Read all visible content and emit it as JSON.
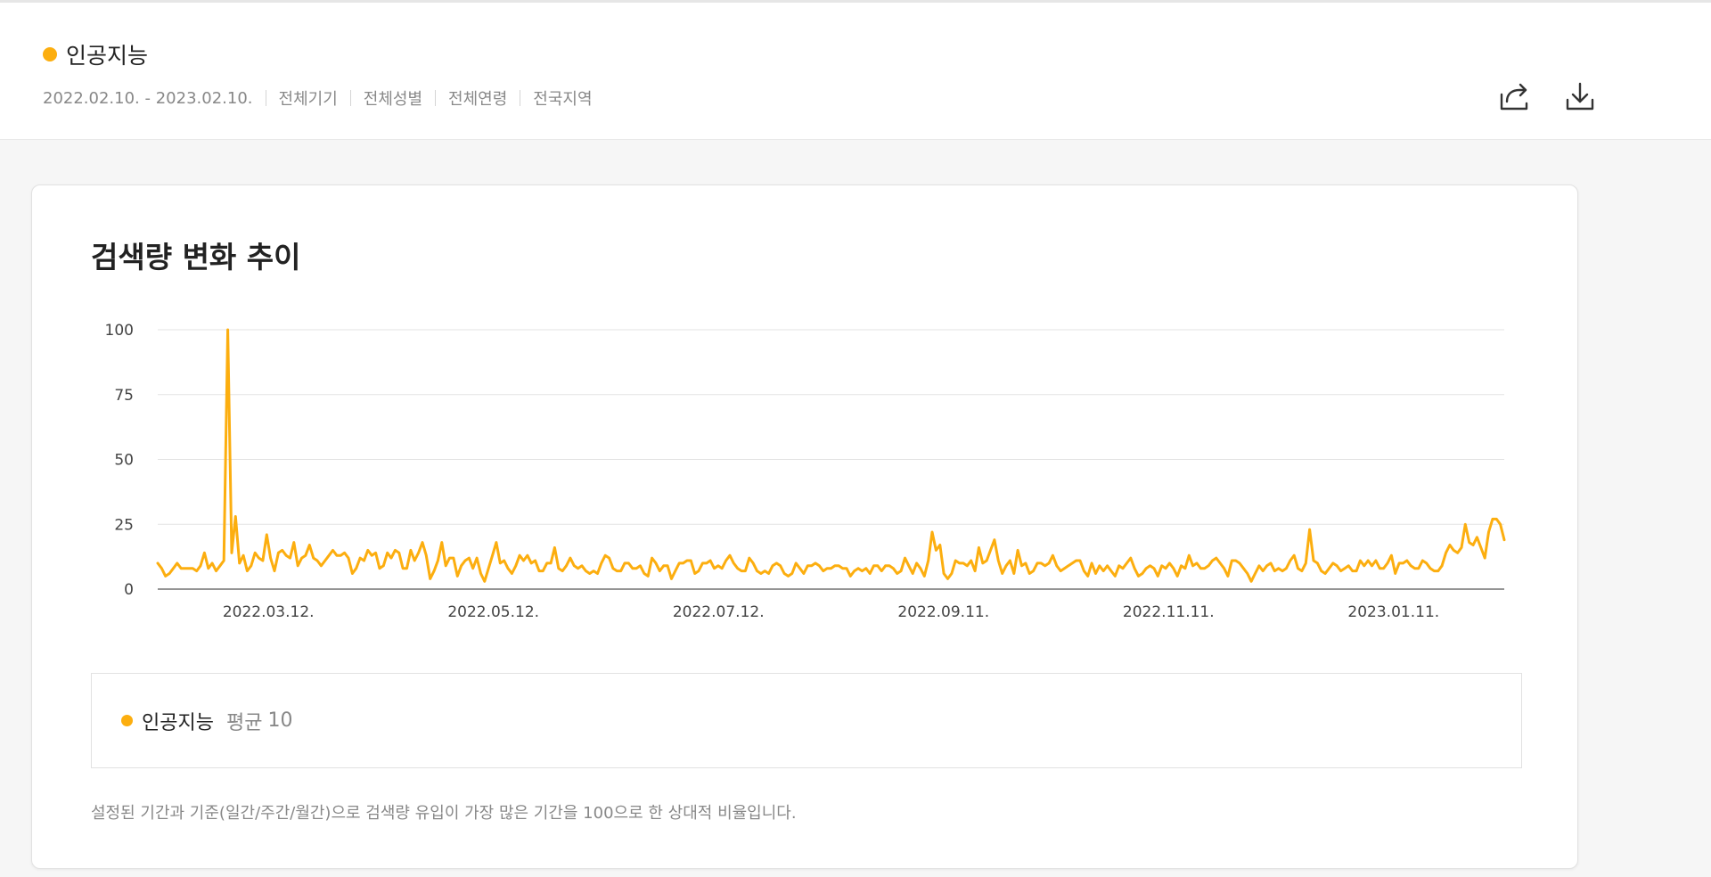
{
  "header": {
    "keyword": "인공지능",
    "filters": [
      "2022.02.10. - 2023.02.10.",
      "전체기기",
      "전체성별",
      "전체연령",
      "전국지역"
    ],
    "share_icon": "share-icon",
    "download_icon": "download-icon"
  },
  "colors": {
    "accent": "#fcae0f",
    "grid": "#e3e3e3",
    "axis": "#555555"
  },
  "card": {
    "title": "검색량 변화 추이",
    "legend": {
      "name": "인공지능",
      "avg_label": "평균",
      "avg_value": "10"
    },
    "note": "설정된 기간과 기준(일간/주간/월간)으로 검색량 유입이 가장 많은 기간을 100으로 한 상대적 비율입니다."
  },
  "chart_data": {
    "type": "line",
    "title": "검색량 변화 추이",
    "xlabel": "",
    "ylabel": "",
    "ylim": [
      0,
      100
    ],
    "yticks": [
      0,
      25,
      50,
      75,
      100
    ],
    "grid": true,
    "x_start": "2022.02.10.",
    "x_end": "2023.02.10.",
    "xticks": [
      "2022.03.12.",
      "2022.05.12.",
      "2022.07.12.",
      "2022.09.11.",
      "2022.11.11.",
      "2023.01.11."
    ],
    "series": [
      {
        "name": "인공지능",
        "color": "#fcae0f",
        "values": [
          10,
          8,
          5,
          6,
          8,
          10,
          8,
          8,
          8,
          8,
          7,
          9,
          14,
          8,
          10,
          7,
          9,
          11,
          100,
          14,
          28,
          10,
          13,
          7,
          9,
          14,
          12,
          11,
          21,
          12,
          7,
          14,
          15,
          13,
          12,
          18,
          9,
          12,
          13,
          17,
          12,
          11,
          9,
          11,
          13,
          15,
          13,
          13,
          14,
          12,
          6,
          8,
          12,
          11,
          15,
          13,
          14,
          8,
          9,
          14,
          12,
          15,
          14,
          8,
          8,
          15,
          11,
          14,
          18,
          13,
          4,
          7,
          11,
          18,
          9,
          12,
          12,
          5,
          9,
          11,
          12,
          8,
          12,
          6,
          3,
          8,
          13,
          18,
          10,
          11,
          8,
          6,
          9,
          13,
          11,
          13,
          10,
          11,
          7,
          7,
          10,
          10,
          16,
          8,
          7,
          9,
          12,
          9,
          8,
          9,
          7,
          6,
          7,
          6,
          10,
          13,
          12,
          8,
          7,
          7,
          10,
          10,
          8,
          8,
          9,
          6,
          5,
          12,
          10,
          7,
          9,
          9,
          4,
          7,
          10,
          10,
          11,
          11,
          6,
          7,
          10,
          10,
          11,
          8,
          9,
          8,
          11,
          13,
          10,
          8,
          7,
          7,
          12,
          10,
          7,
          6,
          7,
          6,
          9,
          10,
          9,
          6,
          5,
          6,
          10,
          8,
          6,
          9,
          9,
          10,
          9,
          7,
          8,
          8,
          9,
          9,
          8,
          8,
          5,
          7,
          8,
          7,
          8,
          6,
          9,
          9,
          7,
          9,
          9,
          8,
          6,
          7,
          12,
          9,
          6,
          10,
          8,
          5,
          11,
          22,
          15,
          17,
          6,
          4,
          6,
          11,
          10,
          10,
          9,
          11,
          7,
          16,
          10,
          11,
          15,
          19,
          11,
          6,
          9,
          11,
          6,
          15,
          9,
          10,
          6,
          7,
          10,
          10,
          9,
          10,
          13,
          9,
          7,
          8,
          9,
          10,
          11,
          11,
          7,
          5,
          10,
          6,
          9,
          7,
          9,
          7,
          5,
          9,
          8,
          10,
          12,
          8,
          5,
          6,
          8,
          9,
          8,
          5,
          9,
          8,
          10,
          8,
          5,
          9,
          8,
          13,
          9,
          10,
          8,
          8,
          9,
          11,
          12,
          10,
          8,
          5,
          11,
          11,
          10,
          8,
          6,
          3,
          6,
          9,
          7,
          9,
          10,
          7,
          8,
          7,
          8,
          11,
          13,
          8,
          7,
          10,
          23,
          11,
          10,
          7,
          6,
          8,
          10,
          9,
          7,
          8,
          9,
          7,
          7,
          11,
          9,
          11,
          9,
          11,
          8,
          8,
          10,
          13,
          6,
          10,
          10,
          11,
          9,
          8,
          8,
          11,
          10,
          8,
          7,
          7,
          9,
          14,
          17,
          15,
          14,
          16,
          25,
          18,
          17,
          20,
          16,
          12,
          22,
          27,
          27,
          25,
          19
        ]
      }
    ]
  }
}
